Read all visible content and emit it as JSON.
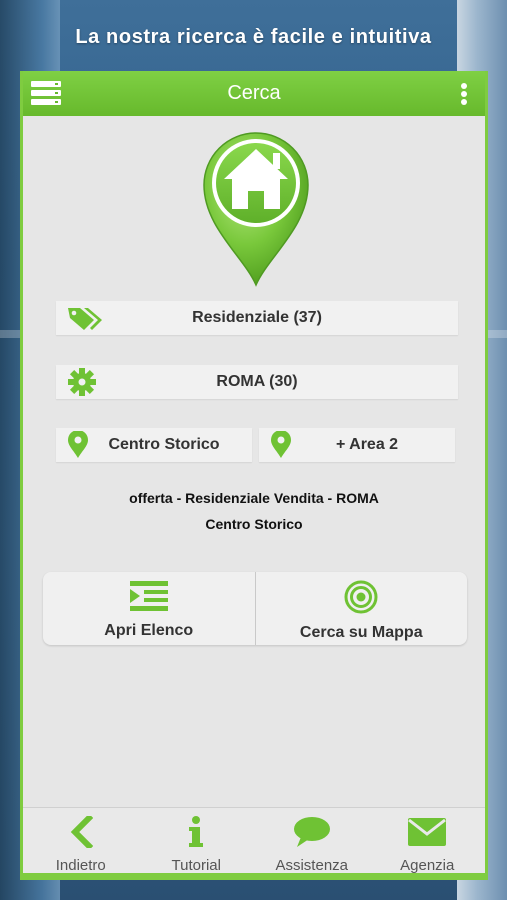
{
  "headline": "La nostra ricerca è facile e intuitiva",
  "topbar": {
    "title": "Cerca"
  },
  "filters": {
    "category": "Residenziale (37)",
    "city": "ROMA (30)",
    "area1": "Centro Storico",
    "area2": "+ Area 2"
  },
  "summary": {
    "line1": "offerta - Residenziale Vendita - ROMA",
    "line2": "Centro Storico"
  },
  "actions": {
    "list_label": "Apri Elenco",
    "map_label": "Cerca su Mappa"
  },
  "bottom_nav": {
    "back": "Indietro",
    "tutorial": "Tutorial",
    "support": "Assistenza",
    "agency": "Agenzia"
  },
  "colors": {
    "accent": "#6fc234",
    "accent_dark": "#58a326",
    "panel": "#e6e6e6"
  }
}
